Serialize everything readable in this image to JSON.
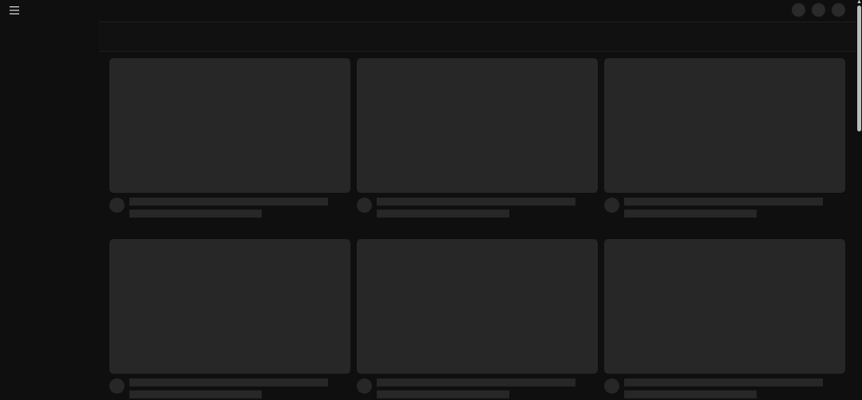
{
  "header": {
    "menu_icon": "hamburger-menu-icon",
    "action_icons": [
      "placeholder-circle",
      "placeholder-circle",
      "placeholder-circle"
    ]
  },
  "colors": {
    "background": "#0f0f0f",
    "skeleton": "#272727",
    "scroll_thumb": "#bdbdbd"
  },
  "content": {
    "state": "loading-skeleton",
    "cards": [
      {
        "loading": true
      },
      {
        "loading": true
      },
      {
        "loading": true
      },
      {
        "loading": true
      },
      {
        "loading": true
      },
      {
        "loading": true
      }
    ]
  }
}
